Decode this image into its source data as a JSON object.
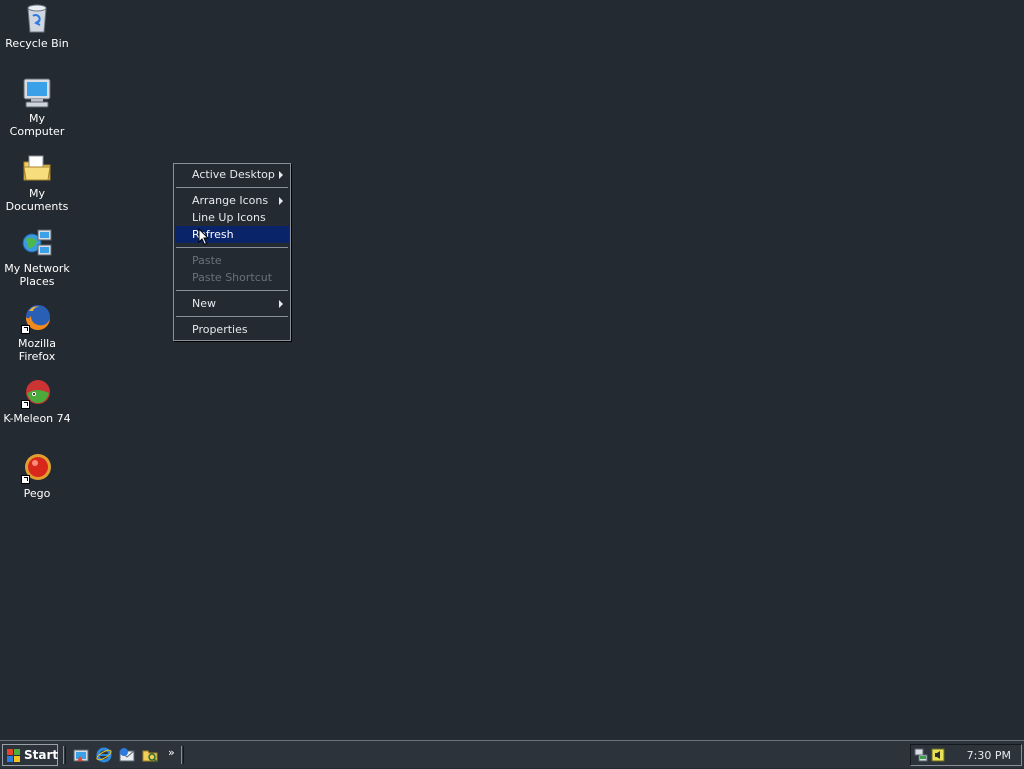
{
  "desktop": {
    "icons": [
      {
        "name": "recycle-bin-icon",
        "label": "Recycle Bin"
      },
      {
        "name": "my-computer-icon",
        "label": "My Computer"
      },
      {
        "name": "my-documents-icon",
        "label": "My Documents"
      },
      {
        "name": "my-network-places-icon",
        "label": "My Network Places"
      },
      {
        "name": "firefox-icon",
        "label": "Mozilla Firefox"
      },
      {
        "name": "k-meleon-icon",
        "label": "K-Meleon 74"
      },
      {
        "name": "pego-icon",
        "label": "Pego"
      }
    ]
  },
  "context_menu": {
    "items": [
      {
        "label": "Active Desktop",
        "submenu": true,
        "enabled": true
      },
      {
        "label": "Arrange Icons",
        "submenu": true,
        "enabled": true
      },
      {
        "label": "Line Up Icons",
        "submenu": false,
        "enabled": true
      },
      {
        "label": "Refresh",
        "submenu": false,
        "enabled": true,
        "highlighted": true
      },
      {
        "label": "Paste",
        "submenu": false,
        "enabled": false
      },
      {
        "label": "Paste Shortcut",
        "submenu": false,
        "enabled": false
      },
      {
        "label": "New",
        "submenu": true,
        "enabled": true
      },
      {
        "label": "Properties",
        "submenu": false,
        "enabled": true
      }
    ]
  },
  "taskbar": {
    "start_label": "Start",
    "quick_launch": [
      "show-desktop-icon",
      "internet-explorer-icon",
      "outlook-express-icon",
      "windows-explorer-icon"
    ],
    "overflow_label": "»",
    "clock": "7:30 PM",
    "tray_icons": [
      "network-icon",
      "volume-icon"
    ]
  },
  "colors": {
    "desktop_background": "#242a31",
    "menu_highlight": "#0a246a"
  }
}
